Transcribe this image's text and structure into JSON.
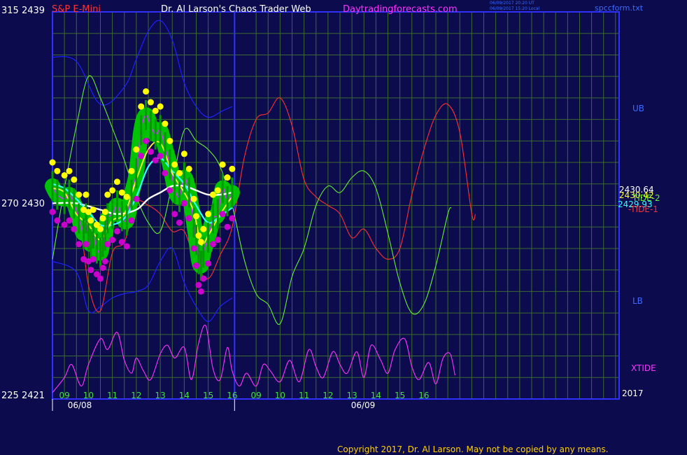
{
  "header": {
    "instrument": "S&P E-Mini",
    "author_title": "Dr. Al Larson's Chaos Trader Web",
    "site": "Daytradingforecasts.com",
    "timestamp_ut": "06/09/2017 20:20 UT",
    "timestamp_local": "06/09/2017 15:20 Local",
    "file": "spccform.txt"
  },
  "y_axis_labels": {
    "top": "315  2439",
    "mid": "270  2430",
    "bottom": "225  2421"
  },
  "right_labels": {
    "ub": "UB",
    "lb": "LB",
    "xtide": "XTIDE",
    "price1": "2430.64",
    "price2": "2430.42",
    "price3": "2429.93",
    "tide2": "TIDE-2",
    "tide1": "-TIDE-1",
    "year": "2017"
  },
  "copyright": "Copyright 2017, Dr. Al Larson. May not be copied by any means.",
  "colors": {
    "background": "#0b0b4d",
    "frame": "#3030ff",
    "grid": "#3d6b2e",
    "header_red": "#ff3333",
    "header_white": "#ffffff",
    "header_magenta": "#ff33ff",
    "price_bar": "#00cc00",
    "price_line": "#cc33ff",
    "yellow_dots": "#ffff00",
    "magenta_dots": "#cc00cc",
    "ma_yellow": "#ffff33",
    "ma_cyan": "#33ffff",
    "ma_white": "#ffffff",
    "band_blue": "#2020ff",
    "tide1_red": "#ff3030",
    "tide2_green": "#66ee33",
    "xtide_magenta": "#ff33ff",
    "copyright": "#ffd000"
  },
  "chart_data": {
    "type": "line",
    "title": "S&P E-Mini",
    "y_left_ticks": [
      {
        "label": "315  2439",
        "osc": 315,
        "price": 2439
      },
      {
        "label": "270  2430",
        "osc": 270,
        "price": 2430
      },
      {
        "label": "225  2421",
        "osc": 225,
        "price": 2421
      }
    ],
    "ylim_price": [
      2421,
      2439
    ],
    "x_day1_label": "06/08",
    "x_day2_label": "06/09",
    "x_day1_hours": [
      "09",
      "10",
      "11",
      "12",
      "13",
      "14",
      "15",
      "16"
    ],
    "x_day2_hours": [
      "09",
      "10",
      "11",
      "12",
      "13",
      "14",
      "15",
      "16"
    ],
    "x_range_hours": [
      8.5,
      32.15
    ],
    "grid": true,
    "last_values": {
      "price1": 2430.64,
      "price2": 2430.42,
      "price3": 2429.93
    },
    "series": [
      {
        "name": "S&P E-Mini",
        "values_h_price": [
          [
            8.5,
            2430.9
          ],
          [
            8.7,
            2430.5
          ],
          [
            9.0,
            2430.3
          ],
          [
            9.2,
            2430.5
          ],
          [
            9.4,
            2430.1
          ],
          [
            9.6,
            2429.4
          ],
          [
            9.8,
            2428.7
          ],
          [
            9.9,
            2429.4
          ],
          [
            10.0,
            2428.6
          ],
          [
            10.1,
            2428.2
          ],
          [
            10.2,
            2428.7
          ],
          [
            10.35,
            2428.0
          ],
          [
            10.5,
            2427.8
          ],
          [
            10.6,
            2428.3
          ],
          [
            10.7,
            2428.6
          ],
          [
            10.8,
            2429.4
          ],
          [
            11.0,
            2429.6
          ],
          [
            11.2,
            2430.0
          ],
          [
            11.4,
            2429.5
          ],
          [
            11.6,
            2429.3
          ],
          [
            11.8,
            2430.5
          ],
          [
            12.0,
            2431.5
          ],
          [
            12.2,
            2433.5
          ],
          [
            12.4,
            2434.2
          ],
          [
            12.6,
            2433.7
          ],
          [
            12.8,
            2433.3
          ],
          [
            13.0,
            2433.5
          ],
          [
            13.2,
            2432.7
          ],
          [
            13.4,
            2431.9
          ],
          [
            13.6,
            2430.8
          ],
          [
            13.8,
            2430.4
          ],
          [
            14.0,
            2431.3
          ],
          [
            14.2,
            2430.6
          ],
          [
            14.4,
            2429.2
          ],
          [
            14.5,
            2428.4
          ],
          [
            14.6,
            2427.5
          ],
          [
            14.7,
            2427.2
          ],
          [
            14.8,
            2427.8
          ],
          [
            15.0,
            2428.5
          ],
          [
            15.2,
            2429.4
          ],
          [
            15.4,
            2429.6
          ],
          [
            15.6,
            2430.8
          ],
          [
            15.8,
            2430.2
          ],
          [
            16.0,
            2430.6
          ]
        ]
      },
      {
        "name": "yellow average",
        "values_h_price": [
          [
            8.5,
            2430.8
          ],
          [
            9.0,
            2430.6
          ],
          [
            9.5,
            2429.6
          ],
          [
            10.0,
            2429.1
          ],
          [
            10.5,
            2428.4
          ],
          [
            11.0,
            2429.3
          ],
          [
            11.5,
            2429.6
          ],
          [
            12.0,
            2431.2
          ],
          [
            12.5,
            2432.6
          ],
          [
            13.0,
            2432.9
          ],
          [
            13.5,
            2431.5
          ],
          [
            14.0,
            2430.6
          ],
          [
            14.4,
            2429.7
          ],
          [
            14.7,
            2428.2
          ],
          [
            15.0,
            2428.6
          ],
          [
            15.4,
            2429.4
          ],
          [
            15.8,
            2430.1
          ],
          [
            16.0,
            2430.4
          ]
        ]
      },
      {
        "name": "cyan average",
        "values_h_price": [
          [
            8.5,
            2431.0
          ],
          [
            9.0,
            2430.8
          ],
          [
            9.5,
            2430.3
          ],
          [
            10.0,
            2429.7
          ],
          [
            10.5,
            2429.1
          ],
          [
            11.0,
            2429.1
          ],
          [
            11.5,
            2429.4
          ],
          [
            12.0,
            2430.4
          ],
          [
            12.5,
            2431.8
          ],
          [
            13.0,
            2432.2
          ],
          [
            13.5,
            2431.6
          ],
          [
            14.0,
            2431.0
          ],
          [
            14.5,
            2430.0
          ],
          [
            15.0,
            2429.2
          ],
          [
            15.5,
            2429.5
          ],
          [
            16.0,
            2429.9
          ]
        ]
      },
      {
        "name": "white average",
        "values_h_price": [
          [
            8.5,
            2430.1
          ],
          [
            9.5,
            2430.1
          ],
          [
            10.5,
            2429.8
          ],
          [
            11.2,
            2429.6
          ],
          [
            12.0,
            2429.8
          ],
          [
            12.5,
            2430.3
          ],
          [
            13.0,
            2430.6
          ],
          [
            13.5,
            2430.9
          ],
          [
            14.0,
            2430.9
          ],
          [
            14.5,
            2430.7
          ],
          [
            15.0,
            2430.5
          ],
          [
            15.5,
            2430.5
          ],
          [
            16.0,
            2430.6
          ]
        ]
      },
      {
        "name": "UB",
        "values_h_price": [
          [
            8.5,
            2436.9
          ],
          [
            9.5,
            2436.7
          ],
          [
            10.5,
            2434.7
          ],
          [
            11.5,
            2435.5
          ],
          [
            12.0,
            2436.8
          ],
          [
            12.5,
            2438.1
          ],
          [
            13.0,
            2438.6
          ],
          [
            13.5,
            2437.7
          ],
          [
            14.0,
            2435.7
          ],
          [
            14.5,
            2434.6
          ],
          [
            15.0,
            2434.1
          ],
          [
            15.6,
            2434.4
          ],
          [
            16.0,
            2434.6
          ]
        ]
      },
      {
        "name": "LB",
        "values_h_price": [
          [
            8.5,
            2427.4
          ],
          [
            9.5,
            2426.9
          ],
          [
            10.0,
            2425.1
          ],
          [
            10.5,
            2425.3
          ],
          [
            11.0,
            2425.7
          ],
          [
            11.5,
            2425.9
          ],
          [
            12.0,
            2426.0
          ],
          [
            12.5,
            2426.3
          ],
          [
            13.0,
            2427.4
          ],
          [
            13.5,
            2428.0
          ],
          [
            14.0,
            2426.4
          ],
          [
            14.5,
            2425.3
          ],
          [
            15.0,
            2424.6
          ],
          [
            15.5,
            2425.3
          ],
          [
            16.0,
            2425.7
          ]
        ]
      },
      {
        "name": "TIDE-1",
        "values_h_price": [
          [
            8.5,
            2430.7
          ],
          [
            9.5,
            2430.0
          ],
          [
            10.0,
            2426.3
          ],
          [
            10.5,
            2425.1
          ],
          [
            11.0,
            2427.8
          ],
          [
            11.5,
            2428.3
          ],
          [
            12.0,
            2430.1
          ],
          [
            12.5,
            2430.0
          ],
          [
            13.0,
            2429.6
          ],
          [
            13.5,
            2428.8
          ],
          [
            14.0,
            2428.8
          ],
          [
            14.5,
            2427.3
          ],
          [
            15.0,
            2426.6
          ],
          [
            15.5,
            2427.7
          ],
          [
            16.0,
            2429.0
          ],
          [
            16.5,
            2432.2
          ],
          [
            17.0,
            2434.0
          ],
          [
            17.5,
            2434.3
          ],
          [
            18.0,
            2435.0
          ],
          [
            18.5,
            2433.7
          ],
          [
            19.0,
            2431.2
          ],
          [
            19.5,
            2430.4
          ],
          [
            20.0,
            2430.0
          ],
          [
            20.5,
            2429.6
          ],
          [
            21.0,
            2428.5
          ],
          [
            21.5,
            2428.9
          ],
          [
            22.0,
            2428.0
          ],
          [
            22.5,
            2427.5
          ],
          [
            23.0,
            2428.0
          ],
          [
            23.5,
            2430.5
          ],
          [
            24.0,
            2432.6
          ],
          [
            24.5,
            2434.2
          ],
          [
            25.0,
            2434.7
          ],
          [
            25.5,
            2433.4
          ],
          [
            26.0,
            2429.6
          ],
          [
            26.15,
            2429.6
          ]
        ]
      },
      {
        "name": "TIDE-2",
        "values_h_price": [
          [
            8.5,
            2427.5
          ],
          [
            9.0,
            2430.8
          ],
          [
            9.5,
            2433.7
          ],
          [
            10.0,
            2436.0
          ],
          [
            10.5,
            2435.0
          ],
          [
            11.0,
            2433.6
          ],
          [
            11.5,
            2432.1
          ],
          [
            12.0,
            2430.4
          ],
          [
            12.5,
            2429.2
          ],
          [
            13.0,
            2428.8
          ],
          [
            13.5,
            2431.0
          ],
          [
            14.0,
            2433.5
          ],
          [
            14.5,
            2433.0
          ],
          [
            15.0,
            2432.6
          ],
          [
            15.5,
            2431.8
          ],
          [
            16.0,
            2430.0
          ],
          [
            16.5,
            2427.5
          ],
          [
            17.0,
            2425.9
          ],
          [
            17.5,
            2425.4
          ],
          [
            18.0,
            2424.5
          ],
          [
            18.5,
            2426.7
          ],
          [
            19.0,
            2428.0
          ],
          [
            19.5,
            2430.0
          ],
          [
            20.0,
            2430.9
          ],
          [
            20.5,
            2430.6
          ],
          [
            21.0,
            2431.3
          ],
          [
            21.5,
            2431.6
          ],
          [
            22.0,
            2430.8
          ],
          [
            22.5,
            2428.7
          ],
          [
            23.0,
            2426.4
          ],
          [
            23.5,
            2425.0
          ],
          [
            24.0,
            2425.4
          ],
          [
            24.5,
            2427.2
          ],
          [
            25.0,
            2429.6
          ],
          [
            25.15,
            2429.9
          ]
        ]
      },
      {
        "name": "XTIDE",
        "values_h_price": [
          [
            8.5,
            2421.3
          ],
          [
            9.0,
            2422.0
          ],
          [
            9.3,
            2422.6
          ],
          [
            9.7,
            2421.6
          ],
          [
            10.0,
            2422.6
          ],
          [
            10.5,
            2423.8
          ],
          [
            10.8,
            2423.3
          ],
          [
            11.2,
            2424.1
          ],
          [
            11.5,
            2422.8
          ],
          [
            11.8,
            2422.2
          ],
          [
            12.0,
            2422.9
          ],
          [
            12.3,
            2422.3
          ],
          [
            12.6,
            2421.9
          ],
          [
            13.0,
            2423.1
          ],
          [
            13.3,
            2423.5
          ],
          [
            13.6,
            2422.9
          ],
          [
            14.0,
            2423.4
          ],
          [
            14.3,
            2421.9
          ],
          [
            14.6,
            2423.6
          ],
          [
            14.9,
            2424.4
          ],
          [
            15.2,
            2422.4
          ],
          [
            15.5,
            2421.9
          ],
          [
            15.8,
            2423.4
          ],
          [
            16.0,
            2422.3
          ],
          [
            16.3,
            2421.6
          ],
          [
            16.6,
            2422.2
          ],
          [
            17.0,
            2421.6
          ],
          [
            17.3,
            2422.6
          ],
          [
            17.6,
            2422.3
          ],
          [
            18.0,
            2421.8
          ],
          [
            18.4,
            2422.8
          ],
          [
            18.8,
            2421.8
          ],
          [
            19.2,
            2423.3
          ],
          [
            19.5,
            2422.5
          ],
          [
            19.8,
            2422.0
          ],
          [
            20.2,
            2423.2
          ],
          [
            20.5,
            2422.6
          ],
          [
            20.8,
            2422.2
          ],
          [
            21.2,
            2423.2
          ],
          [
            21.5,
            2422.0
          ],
          [
            21.8,
            2423.5
          ],
          [
            22.2,
            2422.8
          ],
          [
            22.5,
            2422.2
          ],
          [
            22.8,
            2423.3
          ],
          [
            23.2,
            2423.8
          ],
          [
            23.5,
            2422.5
          ],
          [
            23.8,
            2421.9
          ],
          [
            24.2,
            2422.7
          ],
          [
            24.5,
            2421.7
          ],
          [
            24.8,
            2422.9
          ],
          [
            25.1,
            2423.1
          ],
          [
            25.3,
            2422.1
          ]
        ]
      }
    ]
  }
}
